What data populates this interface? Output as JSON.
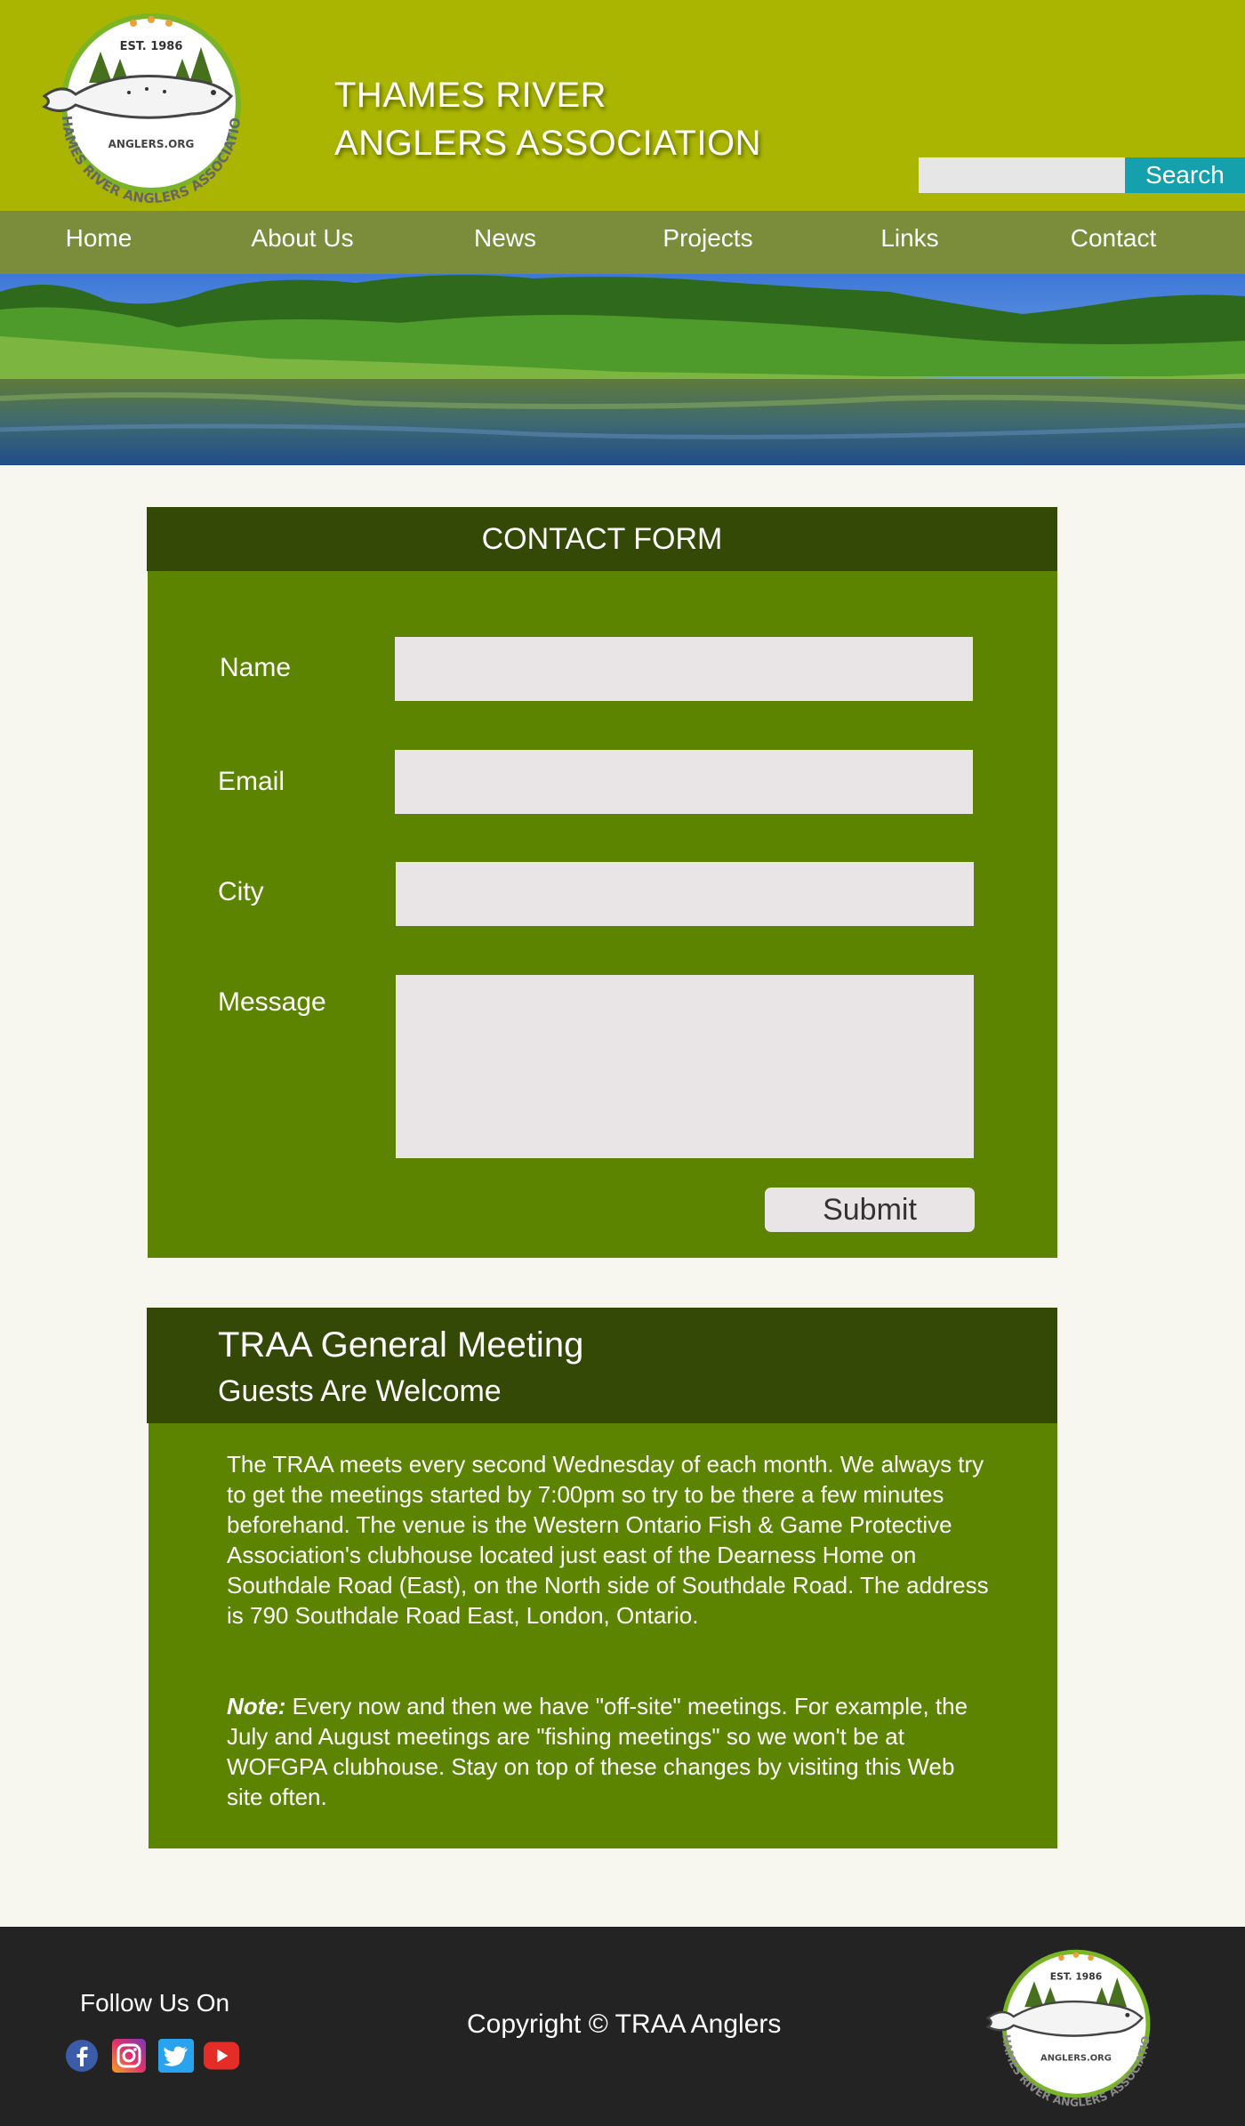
{
  "header": {
    "title_line1": "THAMES RIVER",
    "title_line2": "ANGLERS ASSOCIATION",
    "logo": {
      "est": "EST. 1986",
      "site": "ANGLERS.ORG",
      "ring_text": "THAMES RIVER ANGLERS ASSOCIATION"
    },
    "search_placeholder": "",
    "search_label": "Search"
  },
  "nav": {
    "items": [
      {
        "label": "Home"
      },
      {
        "label": "About Us"
      },
      {
        "label": "News"
      },
      {
        "label": "Projects"
      },
      {
        "label": "Links"
      },
      {
        "label": "Contact"
      }
    ]
  },
  "contact_form": {
    "title": "CONTACT FORM",
    "name_label": "Name",
    "email_label": "Email",
    "city_label": "City",
    "message_label": "Message",
    "name_value": "",
    "email_value": "",
    "city_value": "",
    "message_value": "",
    "submit_label": "Submit"
  },
  "meeting": {
    "title": "TRAA General Meeting",
    "subtitle": "Guests Are Welcome",
    "body": "The TRAA meets every second Wednesday of each month. We always try to get the meetings started by 7:00pm so try to be there a few minutes beforehand. The venue is the Western Ontario Fish & Game Protective Association's clubhouse located just east of the Dearness Home on Southdale Road (East), on the North side of Southdale Road. The address is 790 Southdale Road East, London, Ontario.",
    "note_label": "Note:",
    "note_text": " Every now and then we have \"off-site\" meetings. For example, the July and August meetings are \"fishing meetings\" so we won't be at WOFGPA clubhouse. Stay on top of these changes by visiting this Web site often."
  },
  "footer": {
    "follow_label": "Follow Us On",
    "social": [
      "facebook-icon",
      "instagram-icon",
      "twitter-icon",
      "youtube-icon"
    ],
    "copyright": "Copyright © TRAA Anglers"
  },
  "colors": {
    "header_bg": "#a9b500",
    "nav_bg": "#7b8c3b",
    "panel_dark": "#344906",
    "panel_green": "#5c8401",
    "search_button": "#15a0ad",
    "footer_bg": "#232323",
    "page_bg": "#f7f6ef"
  }
}
